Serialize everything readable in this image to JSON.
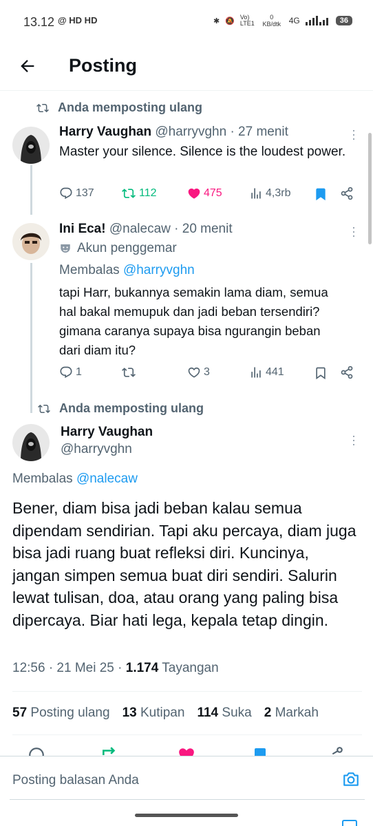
{
  "status_bar": {
    "time": "13.12",
    "left_icons": "@ HD HD",
    "network_speed": "0 KB/dtk",
    "network_type": "4G",
    "battery": "36"
  },
  "header": {
    "title": "Posting"
  },
  "thread": {
    "repost1": "Anda memposting ulang",
    "tweet1": {
      "name": "Harry Vaughan",
      "handle": "@harryvghn",
      "time": "· 27 menit",
      "text": "Master your silence. Silence is the loudest power.",
      "replies": "137",
      "reposts": "112",
      "likes": "475",
      "views": "4,3rb"
    },
    "tweet2": {
      "name": "Ini Eca!",
      "handle": "@nalecaw",
      "time": "· 20 menit",
      "fan_label": "Akun penggemar",
      "replying_to_label": "Membalas",
      "replying_to_handle": "@harryvghn",
      "text": "tapi Harr, bukannya semakin lama diam, semua hal bakal memupuk dan jadi beban tersendiri? gimana caranya supaya bisa ngurangin beban dari diam itu?",
      "replies": "1",
      "likes": "3",
      "views": "441"
    },
    "repost2": "Anda memposting ulang",
    "main": {
      "name": "Harry Vaughan",
      "handle": "@harryvghn",
      "replying_to_label": "Membalas",
      "replying_to_handle": "@nalecaw",
      "text": "Bener, diam bisa jadi beban kalau semua dipendam sendirian. Tapi aku percaya, diam juga bisa jadi ruang buat refleksi diri. Kuncinya, jangan simpen semua buat diri sendiri. Salurin lewat tulisan, doa, atau orang yang paling bisa dipercaya. Biar hati lega, kepala tetap dingin.",
      "time": "12:56 · 21 Mei 25 · ",
      "views_count": "1.174",
      "views_label": " Tayangan",
      "stats": {
        "reposts_count": "57",
        "reposts_label": "Posting ulang",
        "quotes_count": "13",
        "quotes_label": "Kutipan",
        "likes_count": "114",
        "likes_label": "Suka",
        "bookmarks_count": "2",
        "bookmarks_label": "Markah"
      }
    }
  },
  "reply_bar": {
    "placeholder": "Posting balasan Anda"
  },
  "colors": {
    "accent": "#1d9bf0",
    "repost_green": "#00ba7c",
    "like_pink": "#f91880",
    "muted": "#536471"
  }
}
